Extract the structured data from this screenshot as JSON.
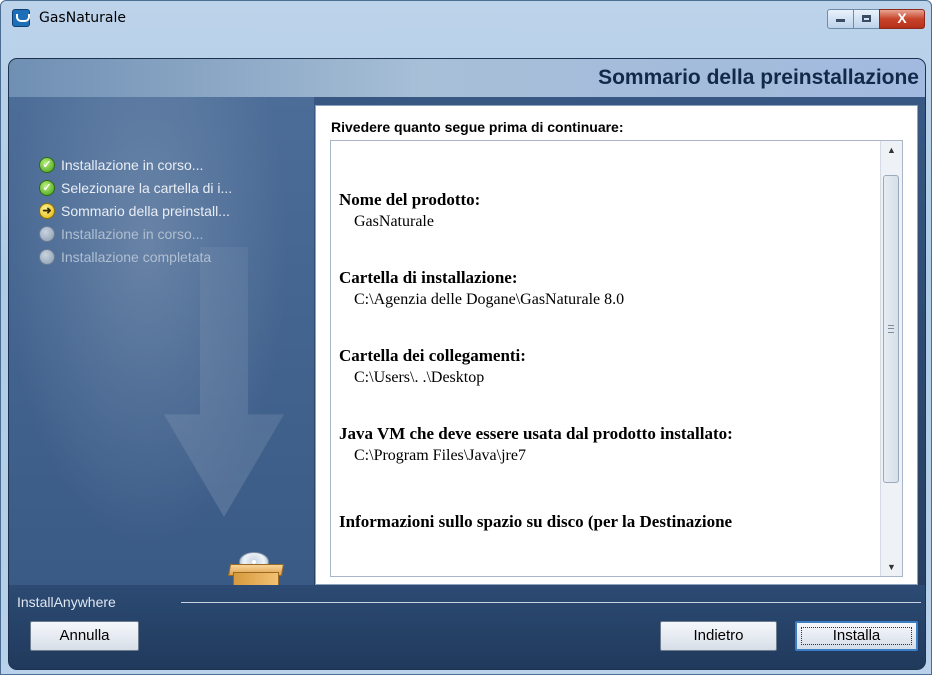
{
  "window": {
    "title": "GasNaturale",
    "controls": {
      "minimize": "",
      "maximize": "",
      "close": "X"
    }
  },
  "header": {
    "title": "Sommario della preinstallazione"
  },
  "steps": [
    {
      "label": "Installazione in corso...",
      "state": "done",
      "icon": "check-icon"
    },
    {
      "label": "Selezionare la cartella di i...",
      "state": "done",
      "icon": "check-icon"
    },
    {
      "label": "Sommario della preinstall...",
      "state": "current",
      "icon": "arrow-right-icon"
    },
    {
      "label": "Installazione in corso...",
      "state": "todo",
      "icon": "circle-icon"
    },
    {
      "label": "Installazione completata",
      "state": "todo",
      "icon": "circle-icon"
    }
  ],
  "content": {
    "intro": "Rivedere quanto segue prima di continuare:",
    "sections": [
      {
        "label": "Nome del prodotto:",
        "value": "GasNaturale"
      },
      {
        "label": "Cartella di installazione:",
        "value": "C:\\Agenzia delle Dogane\\GasNaturale 8.0"
      },
      {
        "label": "Cartella dei collegamenti:",
        "value": "C:\\Users\\.      .\\Desktop"
      },
      {
        "label": "Java VM che deve essere usata dal prodotto installato:",
        "value": "C:\\Program Files\\Java\\jre7"
      },
      {
        "label": "Informazioni sullo spazio su disco (per la Destinazione",
        "value": ""
      }
    ]
  },
  "footer": {
    "brand": "InstallAnywhere",
    "cancel_label": "Annulla",
    "back_label": "Indietro",
    "install_label": "Installa"
  },
  "colors": {
    "header_text": "#13294a",
    "panel_dark": "#2c466c",
    "done_green": "#3f9a16",
    "current_yellow": "#e0b400"
  }
}
